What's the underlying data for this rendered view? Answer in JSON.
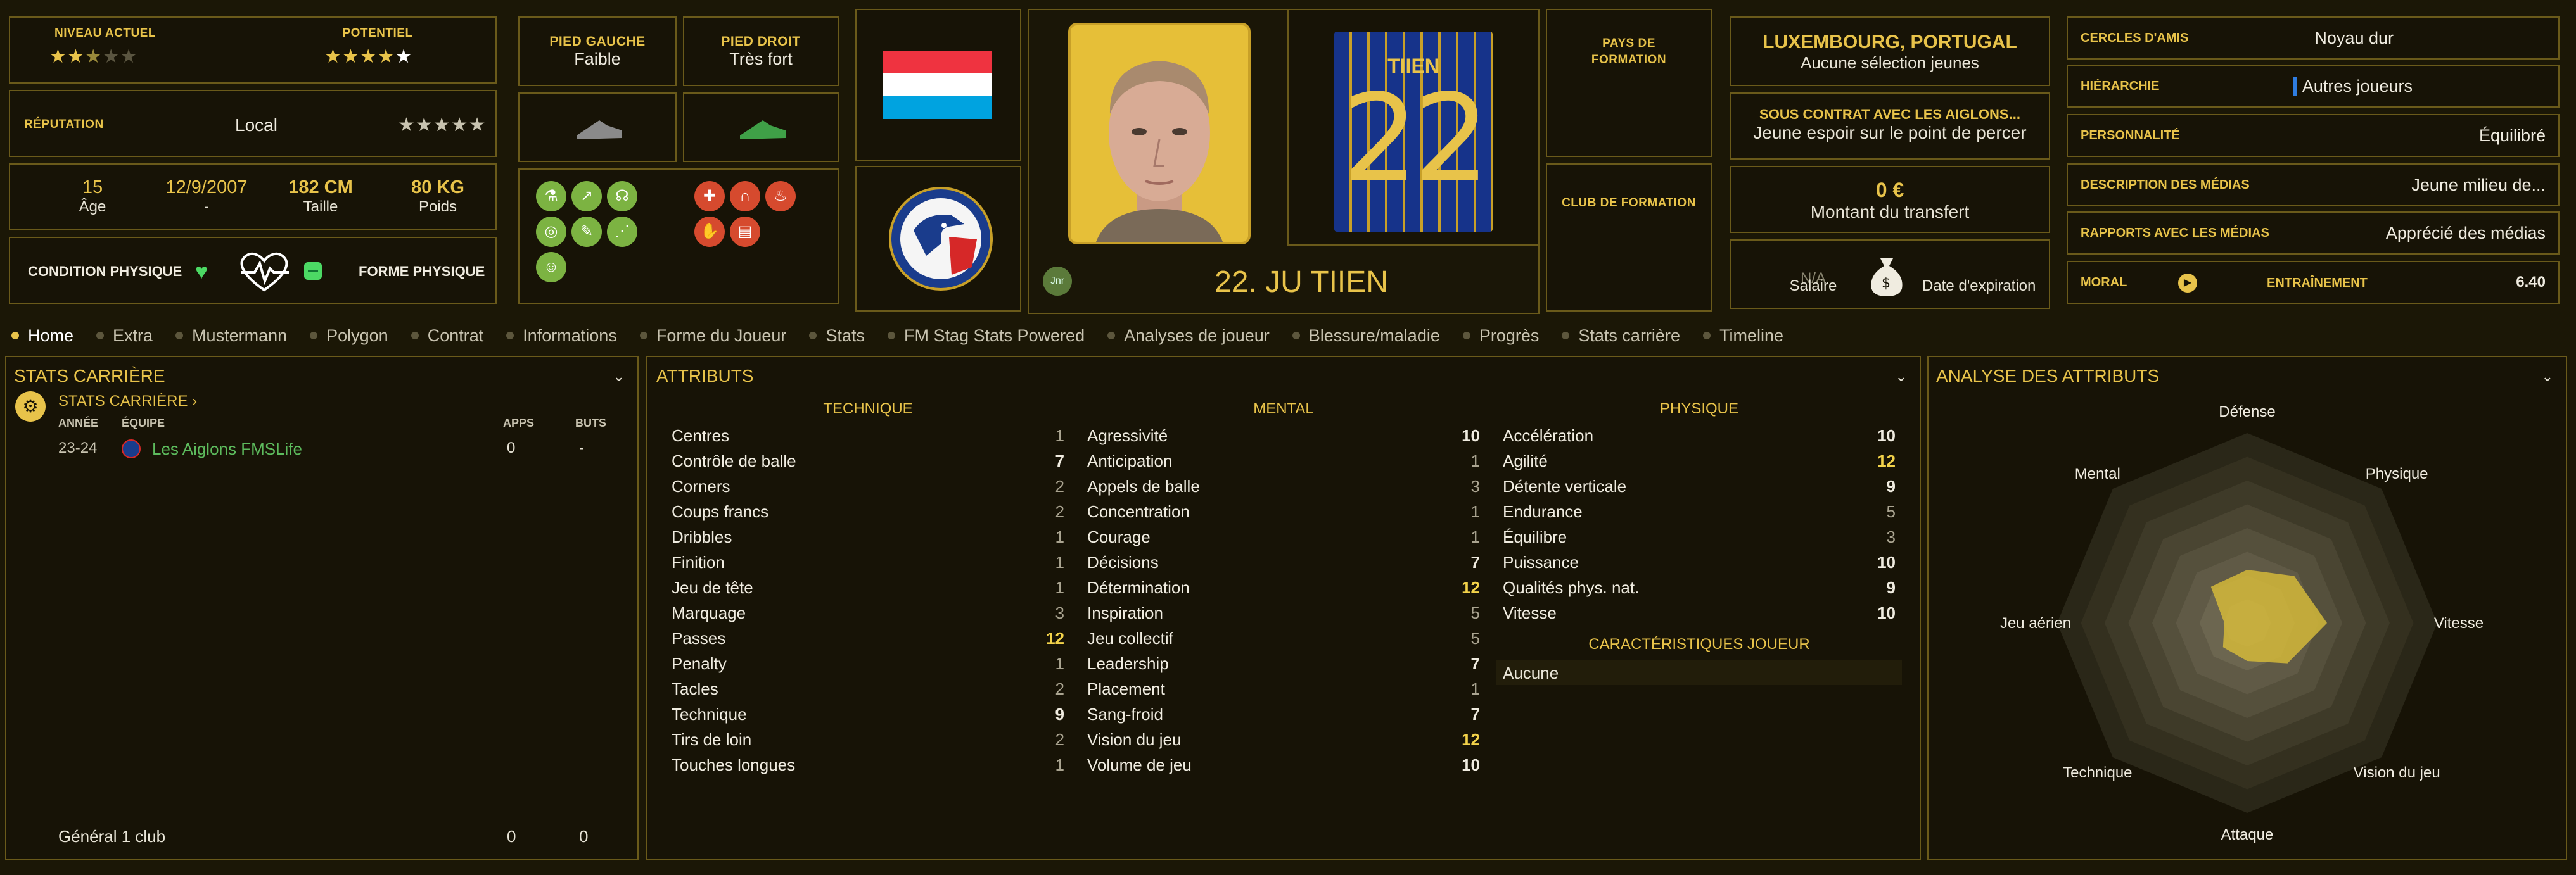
{
  "levels": {
    "current_label": "NIVEAU ACTUEL",
    "potential_label": "POTENTIEL",
    "current_stars": 2.5,
    "potential_stars": 5
  },
  "reputation": {
    "label": "RÉPUTATION",
    "value": "Local"
  },
  "bio": {
    "age": "15",
    "age_label": "Âge",
    "birth": "12/9/2007",
    "birth_label": "-",
    "height": "182 CM",
    "height_label": "Taille",
    "weight": "80 KG",
    "weight_label": "Poids"
  },
  "condition": {
    "label": "CONDITION PHYSIQUE",
    "form_label": "FORME PHYSIQUE"
  },
  "feet": {
    "left_label": "PIED GAUCHE",
    "left_value": "Faible",
    "right_label": "PIED DROIT",
    "right_value": "Très fort"
  },
  "player": {
    "name": "22. JU TIIEN",
    "badge": "Jnr",
    "shirt_name": "TIIEN",
    "shirt_number": "22"
  },
  "training": {
    "country_label": "PAYS DE FORMATION",
    "club_label": "CLUB DE FORMATION"
  },
  "nation": {
    "countries": "LUXEMBOURG, PORTUGAL",
    "selection": "Aucune sélection jeunes",
    "contract_title": "SOUS CONTRAT AVEC LES AIGLONS...",
    "contract_desc": "Jeune espoir sur le point de percer",
    "fee": "0 €",
    "fee_label": "Montant du transfert",
    "salary_value": "N/A",
    "salary_label": "Salaire",
    "expiry_label": "Date d'expiration"
  },
  "side": [
    {
      "label": "CERCLES D'AMIS",
      "value": "Noyau dur"
    },
    {
      "label": "HIÉRARCHIE",
      "value": "Autres joueurs"
    },
    {
      "label": "PERSONNALITÉ",
      "value": "Équilibré"
    },
    {
      "label": "DESCRIPTION DES MÉDIAS",
      "value": "Jeune milieu de..."
    },
    {
      "label": "RAPPORTS AVEC LES MÉDIAS",
      "value": "Apprécié des médias"
    }
  ],
  "morale": {
    "label": "MORAL",
    "training_label": "ENTRAÎNEMENT",
    "training_value": "6.40"
  },
  "tabs": [
    "Home",
    "Extra",
    "Mustermann",
    "Polygon",
    "Contrat",
    "Informations",
    "Forme du Joueur",
    "Stats",
    "FM Stag Stats Powered",
    "Analyses de joueur",
    "Blessure/maladie",
    "Progrès",
    "Stats carrière",
    "Timeline"
  ],
  "career": {
    "title": "STATS CARRIÈRE",
    "link": "STATS CARRIÈRE",
    "col_year": "ANNÉE",
    "col_team": "ÉQUIPE",
    "col_apps": "APPS",
    "col_goals": "BUTS",
    "row": {
      "year": "23-24",
      "team": "Les Aiglons FMSLife",
      "apps": "0",
      "goals": "-"
    },
    "total_label": "Général 1 club",
    "total_apps": "0",
    "total_goals": "0"
  },
  "attributes": {
    "title": "ATTRIBUTS",
    "technical_title": "TECHNIQUE",
    "mental_title": "MENTAL",
    "physical_title": "PHYSIQUE",
    "technical": [
      [
        "Centres",
        "1"
      ],
      [
        "Contrôle de balle",
        "7"
      ],
      [
        "Corners",
        "2"
      ],
      [
        "Coups francs",
        "2"
      ],
      [
        "Dribbles",
        "1"
      ],
      [
        "Finition",
        "1"
      ],
      [
        "Jeu de tête",
        "1"
      ],
      [
        "Marquage",
        "3"
      ],
      [
        "Passes",
        "12"
      ],
      [
        "Penalty",
        "1"
      ],
      [
        "Tacles",
        "2"
      ],
      [
        "Technique",
        "9"
      ],
      [
        "Tirs de loin",
        "2"
      ],
      [
        "Touches longues",
        "1"
      ]
    ],
    "mental": [
      [
        "Agressivité",
        "10"
      ],
      [
        "Anticipation",
        "1"
      ],
      [
        "Appels de balle",
        "3"
      ],
      [
        "Concentration",
        "1"
      ],
      [
        "Courage",
        "1"
      ],
      [
        "Décisions",
        "7"
      ],
      [
        "Détermination",
        "12"
      ],
      [
        "Inspiration",
        "5"
      ],
      [
        "Jeu collectif",
        "5"
      ],
      [
        "Leadership",
        "7"
      ],
      [
        "Placement",
        "1"
      ],
      [
        "Sang-froid",
        "7"
      ],
      [
        "Vision du jeu",
        "12"
      ],
      [
        "Volume de jeu",
        "10"
      ]
    ],
    "physical": [
      [
        "Accélération",
        "10"
      ],
      [
        "Agilité",
        "12"
      ],
      [
        "Détente verticale",
        "9"
      ],
      [
        "Endurance",
        "5"
      ],
      [
        "Équilibre",
        "3"
      ],
      [
        "Puissance",
        "10"
      ],
      [
        "Qualités phys. nat.",
        "9"
      ],
      [
        "Vitesse",
        "10"
      ]
    ],
    "traits_title": "CARACTÉRISTIQUES JOUEUR",
    "traits_value": "Aucune"
  },
  "analysis": {
    "title": "ANALYSE DES ATTRIBUTS",
    "axes": [
      "Défense",
      "Physique",
      "Vitesse",
      "Vision du jeu",
      "Attaque",
      "Technique",
      "Jeu aérien",
      "Mental"
    ],
    "values": [
      0.28,
      0.35,
      0.42,
      0.3,
      0.2,
      0.18,
      0.12,
      0.27
    ],
    "max": 1,
    "fill": "#d4b83a"
  },
  "colors": {
    "accent": "#e8c34a",
    "positive": "#4cd964",
    "panel_border": "#6a5a1a"
  }
}
